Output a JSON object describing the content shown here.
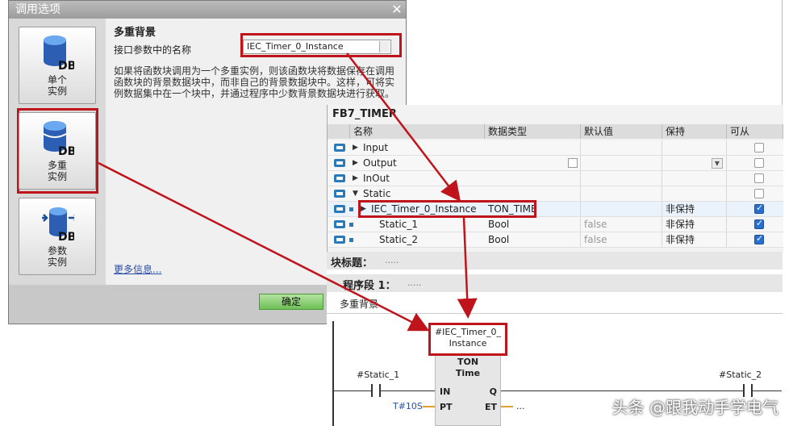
{
  "dialog": {
    "title": "调用选项",
    "close_glyph": "✕",
    "options": [
      {
        "label_line1": "单个",
        "label_line2": "实例",
        "icon_text": "DB"
      },
      {
        "label_line1": "多重",
        "label_line2": "实例",
        "icon_text": "DB"
      },
      {
        "label_line1": "参数",
        "label_line2": "实例",
        "icon_text": "DB"
      }
    ],
    "section_title": "多重背景",
    "field_label": "接口参数中的名称",
    "field_value": "IEC_Timer_0_Instance",
    "description": "如果将函数块调用为一个多重实例，则该函数块将数据保存在调用函数块的背景数据块中，而非自己的背景数据块中。这样，可将实例数据集中在一个块中，并通过程序中少数背景数据块进行获取。",
    "more_info": "更多信息...",
    "ok_label": "确定"
  },
  "fb": {
    "title": "FB7_TIMER",
    "headers": [
      "名称",
      "数据类型",
      "默认值",
      "保持",
      "可从 HMI/..."
    ],
    "rows": [
      {
        "name": "Input",
        "type": "",
        "default": "",
        "retain": "",
        "checked": false,
        "expand": "▶"
      },
      {
        "name": "Output",
        "type": "",
        "default": "",
        "retain": "",
        "checked": false,
        "expand": "▶"
      },
      {
        "name": "InOut",
        "type": "",
        "default": "",
        "retain": "",
        "checked": false,
        "expand": "▶"
      },
      {
        "name": "Static",
        "type": "",
        "default": "",
        "retain": "",
        "checked": false,
        "expand": "▼"
      },
      {
        "name": "IEC_Timer_0_Instance",
        "type": "TON_TIME",
        "default": "",
        "retain": "非保持",
        "checked": true,
        "expand": "▶"
      },
      {
        "name": "Static_1",
        "type": "Bool",
        "default": "false",
        "retain": "非保持",
        "checked": true,
        "expand": ""
      },
      {
        "name": "Static_2",
        "type": "Bool",
        "default": "false",
        "retain": "非保持",
        "checked": true,
        "expand": ""
      }
    ]
  },
  "block": {
    "block_title_label": "块标题：",
    "block_title_value": ".....",
    "network_label": "程序段 1：",
    "network_value": ".....",
    "network_comment": "多重背景",
    "instance_line1": "#IEC_Timer_0_",
    "instance_line2": "Instance",
    "ton_type": "TON",
    "ton_sub": "Time",
    "contact_left": "#Static_1",
    "contact_right": "#Static_2",
    "pin_in": "IN",
    "pin_q": "Q",
    "pin_pt": "PT",
    "pin_et": "ET",
    "pt_value": "T#10S",
    "et_value": "..."
  },
  "watermark": "头条 @跟我动手学电气",
  "colors": {
    "highlight": "#c0141c",
    "io_icon": "#2a7ab8",
    "ok_button": "#6dbf55"
  }
}
